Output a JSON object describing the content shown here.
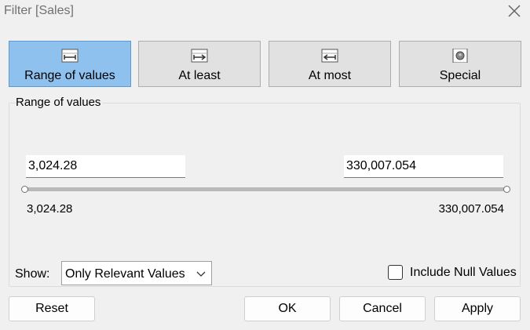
{
  "window": {
    "title": "Filter [Sales]"
  },
  "modes": [
    {
      "label": "Range of values",
      "icon": "range-icon",
      "active": true
    },
    {
      "label": "At least",
      "icon": "at-least-icon",
      "active": false
    },
    {
      "label": "At most",
      "icon": "at-most-icon",
      "active": false
    },
    {
      "label": "Special",
      "icon": "special-icon",
      "active": false
    }
  ],
  "range": {
    "group_title": "Range of values",
    "min_value": "3,024.28",
    "max_value": "330,007.054",
    "min_label": "3,024.28",
    "max_label": "330,007.054",
    "slider_low": 0,
    "slider_high": 1
  },
  "show": {
    "label": "Show:",
    "selected": "Only Relevant Values"
  },
  "include_null": {
    "label": "Include Null Values",
    "checked": false
  },
  "buttons": {
    "reset": "Reset",
    "ok": "OK",
    "cancel": "Cancel",
    "apply": "Apply"
  },
  "colors": {
    "active_mode": "#8ec1ed",
    "button_face": "#e1e1e1",
    "background": "#f0f0f0"
  }
}
